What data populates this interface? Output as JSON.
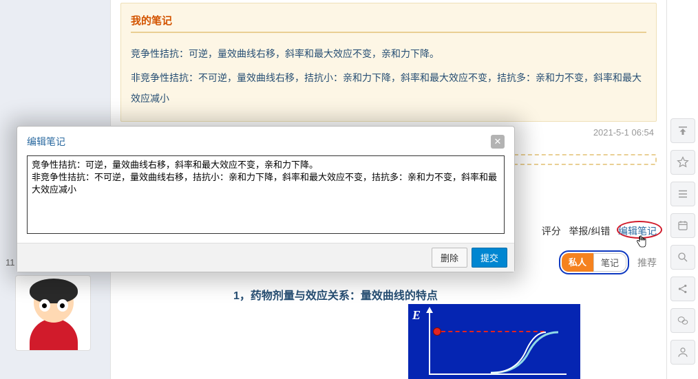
{
  "left": {
    "page_number": "11"
  },
  "notes_panel": {
    "title": "我的笔记",
    "line1": "竞争性拮抗：可逆，量效曲线右移，斜率和最大效应不变，亲和力下降。",
    "line2": "非竞争性拮抗：不可逆，量效曲线右移，拮抗小：亲和力下降，斜率和最大效应不变，拮抗多：亲和力不变，斜率和最大效应减小",
    "date": "2021-5-1 06:54"
  },
  "actions": {
    "rate": "评分",
    "report": "举报/纠错",
    "edit": "编辑笔记"
  },
  "tags": {
    "private": "私人",
    "note": "笔记",
    "recommend": "推荐"
  },
  "section_heading": "1，药物剂量与效应关系：量效曲线的特点",
  "chart": {
    "y_label": "E"
  },
  "modal": {
    "title": "编辑笔记",
    "textarea_value": "竞争性拮抗：可逆，量效曲线右移，斜率和最大效应不变，亲和力下降。\n非竞争性拮抗：不可逆，量效曲线右移，拮抗小：亲和力下降，斜率和最大效应不变，拮抗多：亲和力不变，斜率和最大效应减小",
    "delete": "删除",
    "submit": "提交"
  }
}
